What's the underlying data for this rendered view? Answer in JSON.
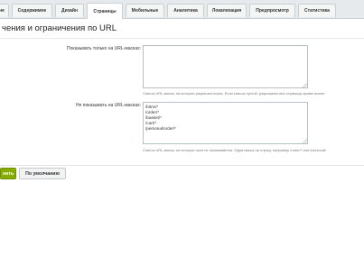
{
  "tabs": [
    {
      "label": "не",
      "active": false
    },
    {
      "label": "Содержимое",
      "active": false
    },
    {
      "label": "Дизайн",
      "active": false
    },
    {
      "label": "Страницы",
      "active": true
    },
    {
      "label": "Мобильные",
      "active": false
    },
    {
      "label": "Аналитика",
      "active": false
    },
    {
      "label": "Локализация",
      "active": false
    },
    {
      "label": "Предпросмотр",
      "active": false
    },
    {
      "label": "Статистика",
      "active": false
    }
  ],
  "page": {
    "title": "чения и ограничения по URL"
  },
  "fields": {
    "show_only": {
      "label": "Показывать только на URL-масках:",
      "value": "",
      "hint": "Список URL-масок, на которых разрешен показ. Если список пустой, разрешены все страницы кроме исклю"
    },
    "hide_on": {
      "label": "Не показывать на URL-масках:",
      "value": "/bitrix/*\n/order/*\n/basket/*\n/cart/*\n/personal/order/*",
      "hint": "Список URL-масок, на которых окно не показывается. Одна маска на строку, например /order/* или /personal/"
    }
  },
  "buttons": {
    "save": "нить",
    "default": "По умолчанию"
  },
  "colors": {
    "accent": "#86ad00",
    "tab_bar": "#e6eaec"
  }
}
